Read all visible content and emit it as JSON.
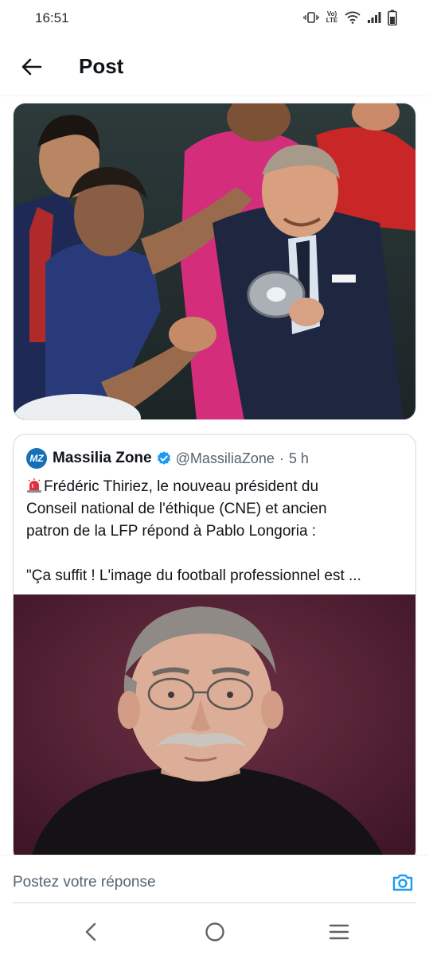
{
  "status_bar": {
    "time": "16:51",
    "volte_label": "Vo) LTE",
    "icons": [
      "vibrate-icon",
      "volte-icon",
      "wifi-icon",
      "signal-icon",
      "battery-icon"
    ]
  },
  "header": {
    "title": "Post",
    "back_icon": "arrow-left-icon"
  },
  "post_media": {
    "description_icon": "photo"
  },
  "quoted_post": {
    "avatar_text": "MZ",
    "author_name": "Massilia Zone",
    "verified_icon": "verified-badge-icon",
    "handle": "@MassiliaZone",
    "separator": "·",
    "age": "5 h",
    "emoji": "siren-icon",
    "text_line1": "Frédéric Thiriez, le nouveau président du",
    "text_line2": "Conseil national de l'éthique (CNE) et ancien",
    "text_line3": "patron de la LFP répond à Pablo Longoria :",
    "text_line4": "\"Ça suffit ! L'image du football professionnel est ..."
  },
  "reply": {
    "placeholder": "Postez votre réponse",
    "camera_icon": "camera-icon"
  },
  "nav": {
    "icons": [
      "back-nav-icon",
      "home-nav-icon",
      "recents-nav-icon"
    ]
  },
  "colors": {
    "accent": "#1d9bf0",
    "text": "#0f1419",
    "muted": "#536471",
    "border": "#cfd9de"
  }
}
